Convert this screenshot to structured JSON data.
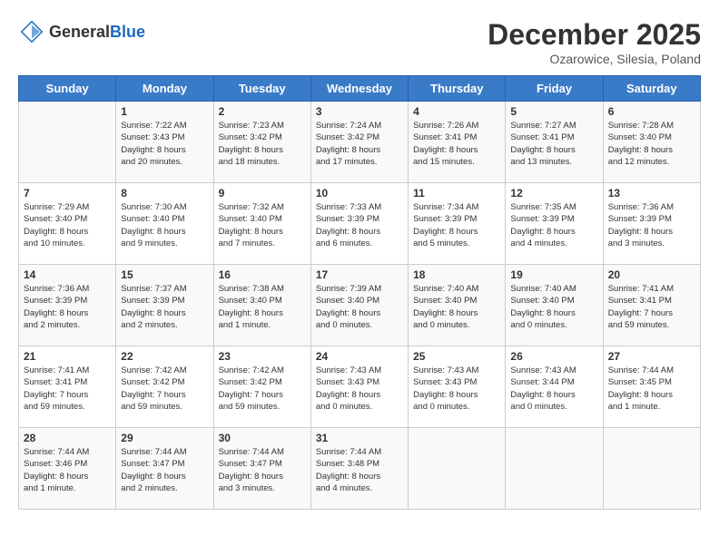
{
  "header": {
    "logo_general": "General",
    "logo_blue": "Blue",
    "month_title": "December 2025",
    "location": "Ozarowice, Silesia, Poland"
  },
  "days_of_week": [
    "Sunday",
    "Monday",
    "Tuesday",
    "Wednesday",
    "Thursday",
    "Friday",
    "Saturday"
  ],
  "weeks": [
    [
      {
        "day": "",
        "info": ""
      },
      {
        "day": "1",
        "info": "Sunrise: 7:22 AM\nSunset: 3:43 PM\nDaylight: 8 hours\nand 20 minutes."
      },
      {
        "day": "2",
        "info": "Sunrise: 7:23 AM\nSunset: 3:42 PM\nDaylight: 8 hours\nand 18 minutes."
      },
      {
        "day": "3",
        "info": "Sunrise: 7:24 AM\nSunset: 3:42 PM\nDaylight: 8 hours\nand 17 minutes."
      },
      {
        "day": "4",
        "info": "Sunrise: 7:26 AM\nSunset: 3:41 PM\nDaylight: 8 hours\nand 15 minutes."
      },
      {
        "day": "5",
        "info": "Sunrise: 7:27 AM\nSunset: 3:41 PM\nDaylight: 8 hours\nand 13 minutes."
      },
      {
        "day": "6",
        "info": "Sunrise: 7:28 AM\nSunset: 3:40 PM\nDaylight: 8 hours\nand 12 minutes."
      }
    ],
    [
      {
        "day": "7",
        "info": "Sunrise: 7:29 AM\nSunset: 3:40 PM\nDaylight: 8 hours\nand 10 minutes."
      },
      {
        "day": "8",
        "info": "Sunrise: 7:30 AM\nSunset: 3:40 PM\nDaylight: 8 hours\nand 9 minutes."
      },
      {
        "day": "9",
        "info": "Sunrise: 7:32 AM\nSunset: 3:40 PM\nDaylight: 8 hours\nand 7 minutes."
      },
      {
        "day": "10",
        "info": "Sunrise: 7:33 AM\nSunset: 3:39 PM\nDaylight: 8 hours\nand 6 minutes."
      },
      {
        "day": "11",
        "info": "Sunrise: 7:34 AM\nSunset: 3:39 PM\nDaylight: 8 hours\nand 5 minutes."
      },
      {
        "day": "12",
        "info": "Sunrise: 7:35 AM\nSunset: 3:39 PM\nDaylight: 8 hours\nand 4 minutes."
      },
      {
        "day": "13",
        "info": "Sunrise: 7:36 AM\nSunset: 3:39 PM\nDaylight: 8 hours\nand 3 minutes."
      }
    ],
    [
      {
        "day": "14",
        "info": "Sunrise: 7:36 AM\nSunset: 3:39 PM\nDaylight: 8 hours\nand 2 minutes."
      },
      {
        "day": "15",
        "info": "Sunrise: 7:37 AM\nSunset: 3:39 PM\nDaylight: 8 hours\nand 2 minutes."
      },
      {
        "day": "16",
        "info": "Sunrise: 7:38 AM\nSunset: 3:40 PM\nDaylight: 8 hours\nand 1 minute."
      },
      {
        "day": "17",
        "info": "Sunrise: 7:39 AM\nSunset: 3:40 PM\nDaylight: 8 hours\nand 0 minutes."
      },
      {
        "day": "18",
        "info": "Sunrise: 7:40 AM\nSunset: 3:40 PM\nDaylight: 8 hours\nand 0 minutes."
      },
      {
        "day": "19",
        "info": "Sunrise: 7:40 AM\nSunset: 3:40 PM\nDaylight: 8 hours\nand 0 minutes."
      },
      {
        "day": "20",
        "info": "Sunrise: 7:41 AM\nSunset: 3:41 PM\nDaylight: 7 hours\nand 59 minutes."
      }
    ],
    [
      {
        "day": "21",
        "info": "Sunrise: 7:41 AM\nSunset: 3:41 PM\nDaylight: 7 hours\nand 59 minutes."
      },
      {
        "day": "22",
        "info": "Sunrise: 7:42 AM\nSunset: 3:42 PM\nDaylight: 7 hours\nand 59 minutes."
      },
      {
        "day": "23",
        "info": "Sunrise: 7:42 AM\nSunset: 3:42 PM\nDaylight: 7 hours\nand 59 minutes."
      },
      {
        "day": "24",
        "info": "Sunrise: 7:43 AM\nSunset: 3:43 PM\nDaylight: 8 hours\nand 0 minutes."
      },
      {
        "day": "25",
        "info": "Sunrise: 7:43 AM\nSunset: 3:43 PM\nDaylight: 8 hours\nand 0 minutes."
      },
      {
        "day": "26",
        "info": "Sunrise: 7:43 AM\nSunset: 3:44 PM\nDaylight: 8 hours\nand 0 minutes."
      },
      {
        "day": "27",
        "info": "Sunrise: 7:44 AM\nSunset: 3:45 PM\nDaylight: 8 hours\nand 1 minute."
      }
    ],
    [
      {
        "day": "28",
        "info": "Sunrise: 7:44 AM\nSunset: 3:46 PM\nDaylight: 8 hours\nand 1 minute."
      },
      {
        "day": "29",
        "info": "Sunrise: 7:44 AM\nSunset: 3:47 PM\nDaylight: 8 hours\nand 2 minutes."
      },
      {
        "day": "30",
        "info": "Sunrise: 7:44 AM\nSunset: 3:47 PM\nDaylight: 8 hours\nand 3 minutes."
      },
      {
        "day": "31",
        "info": "Sunrise: 7:44 AM\nSunset: 3:48 PM\nDaylight: 8 hours\nand 4 minutes."
      },
      {
        "day": "",
        "info": ""
      },
      {
        "day": "",
        "info": ""
      },
      {
        "day": "",
        "info": ""
      }
    ]
  ]
}
